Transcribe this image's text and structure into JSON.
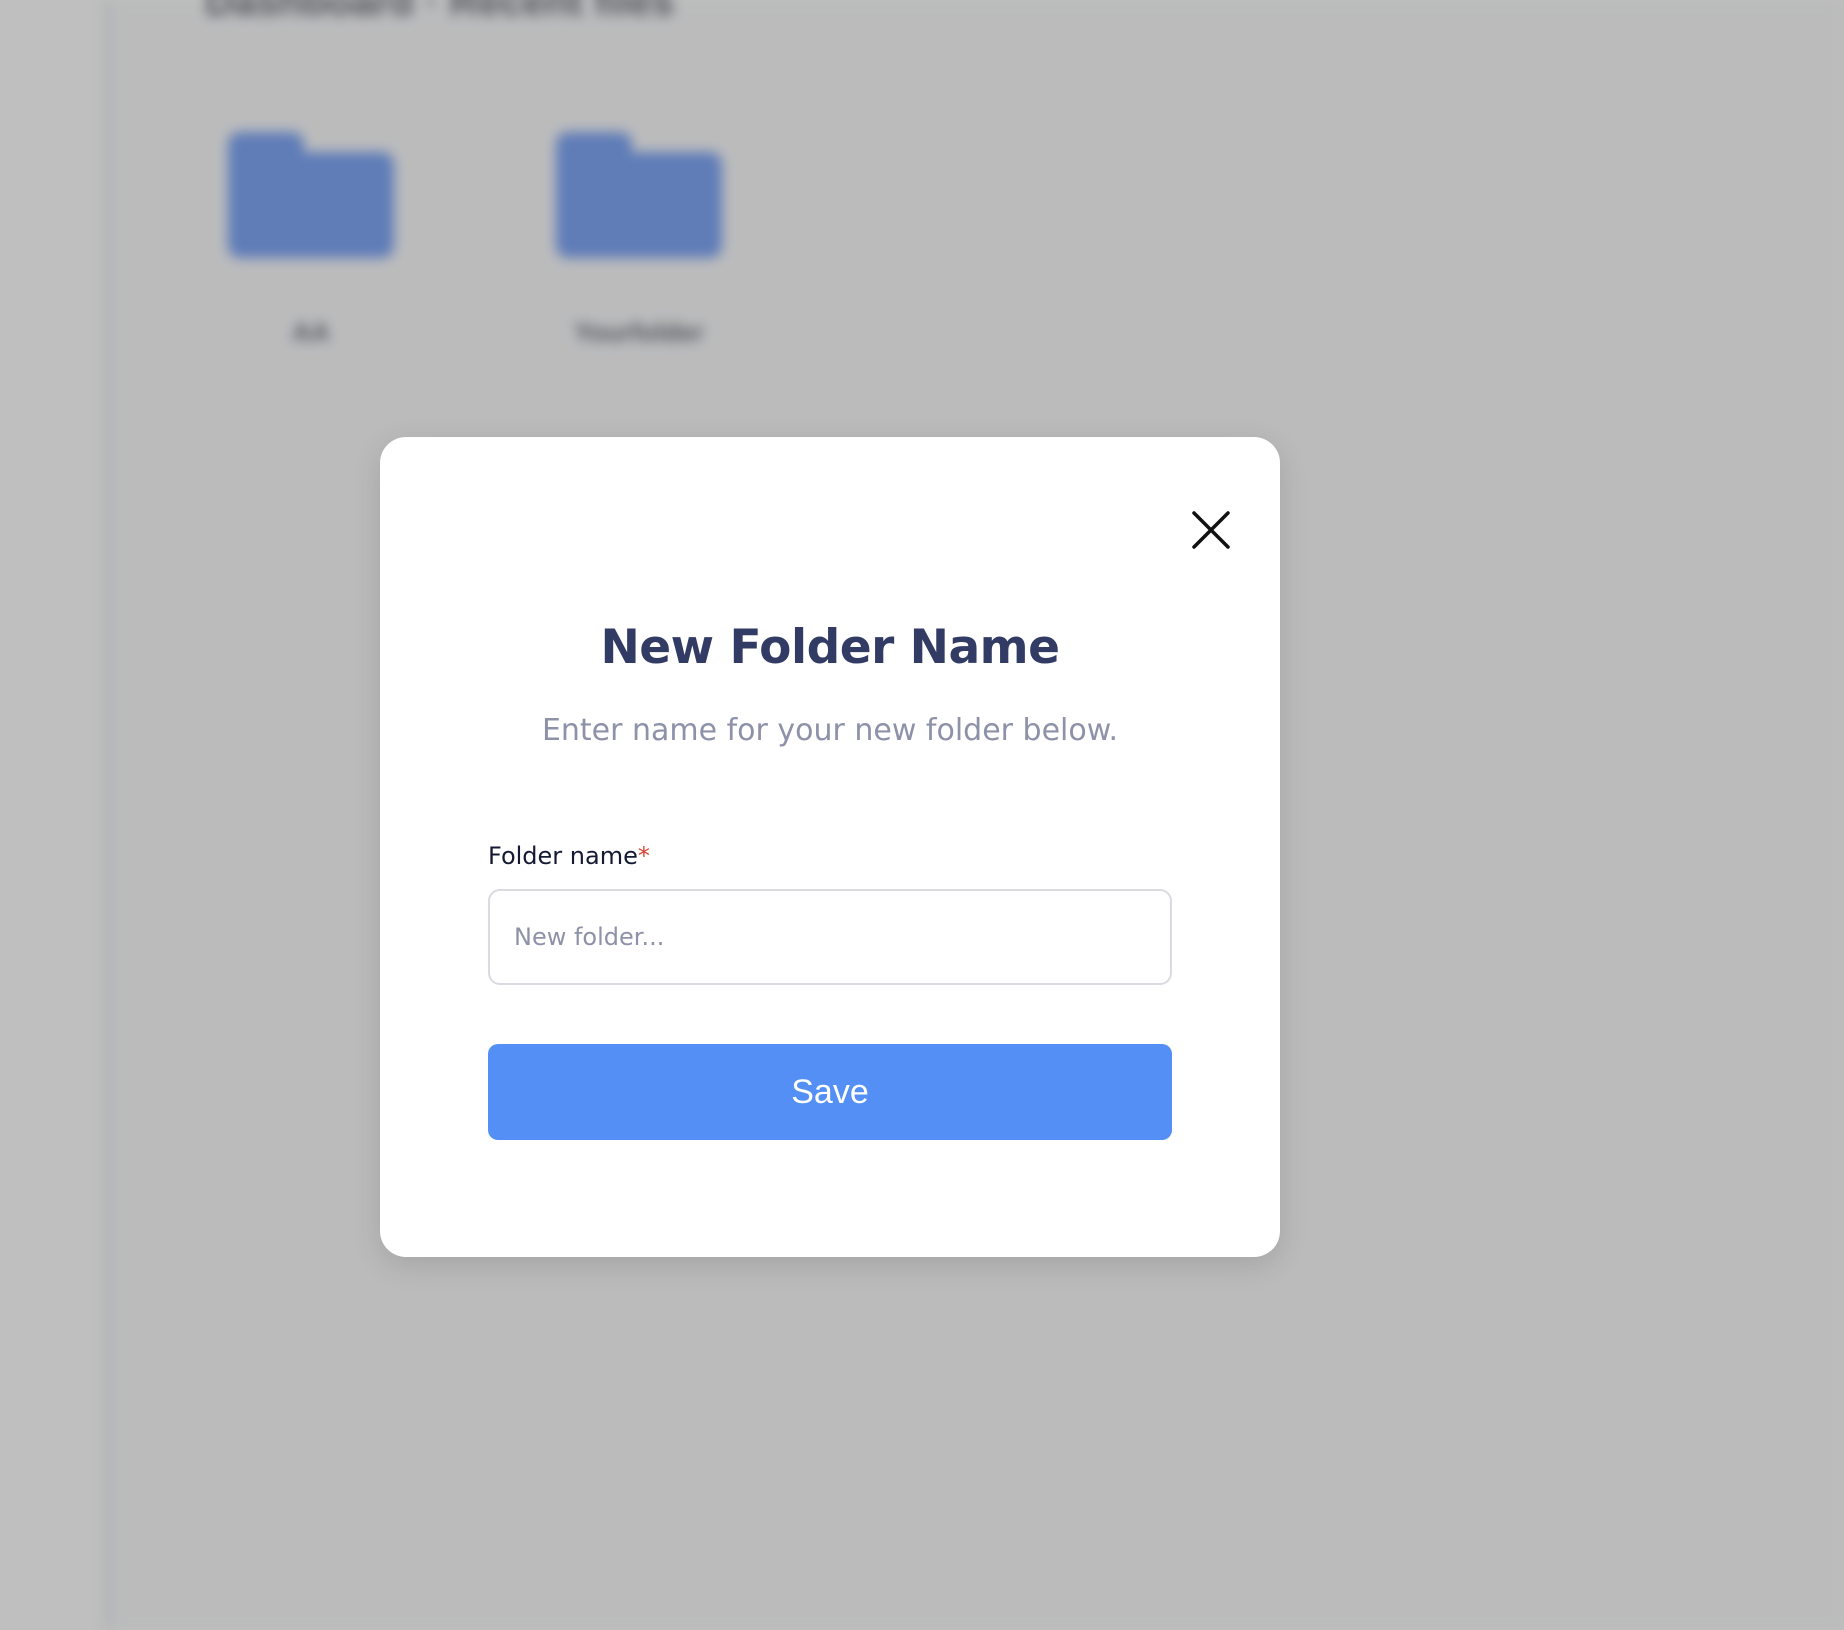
{
  "background": {
    "heading": "Dashboard · Recent files",
    "folders": [
      {
        "name": "AA",
        "color": "#5287f3"
      },
      {
        "name": "Yourfolder",
        "color": "#5287f3"
      }
    ]
  },
  "modal": {
    "title": "New Folder Name",
    "subtitle": "Enter name for your new folder below.",
    "field_label": "Folder name",
    "required_mark": "*",
    "input": {
      "value": "",
      "placeholder": "New folder..."
    },
    "save_label": "Save",
    "close_icon": "close-icon"
  },
  "colors": {
    "accent": "#548ff5",
    "title": "#323b63",
    "subtitle": "#8d92a8",
    "required": "#d6452e",
    "overlay": "#707070"
  }
}
